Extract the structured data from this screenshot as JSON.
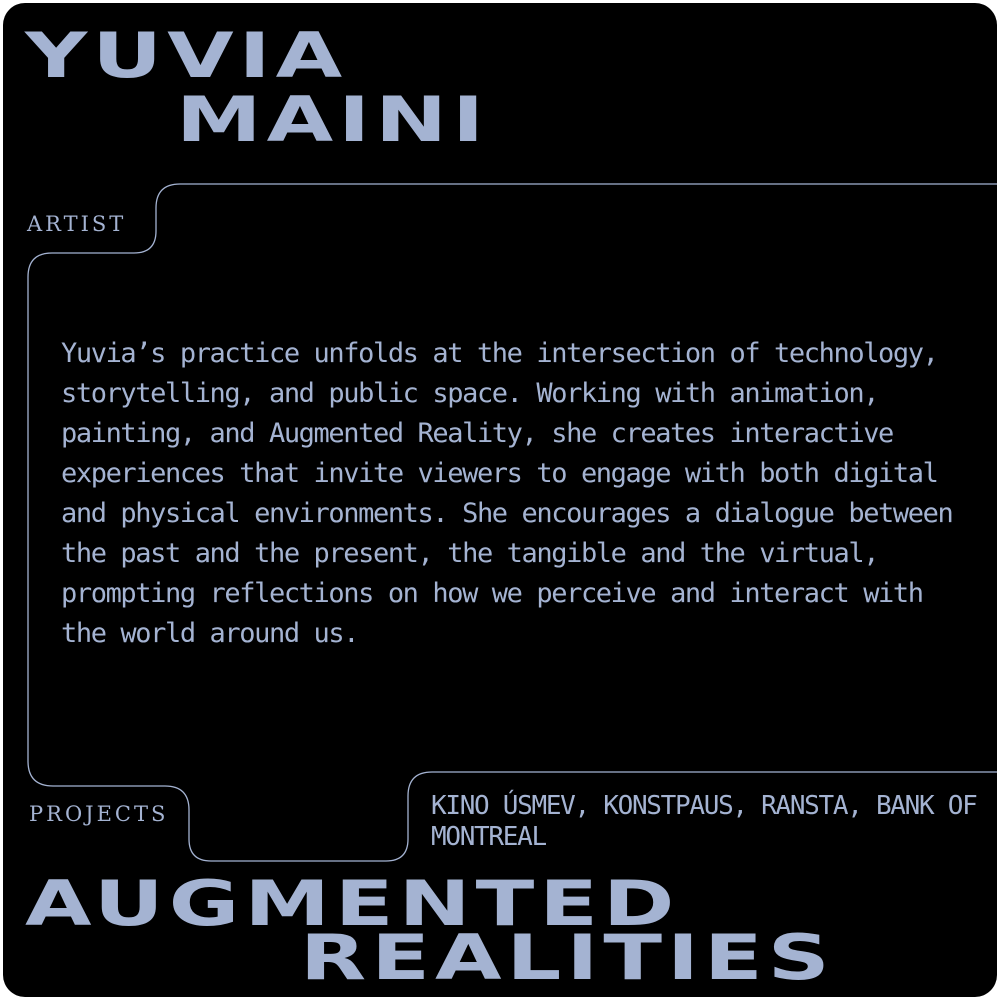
{
  "header": {
    "title_line_1": "YUVIA",
    "title_line_2": "MAINI"
  },
  "artist": {
    "label": "ARTIST",
    "bio": "Yuvia’s practice unfolds at the intersection of technology, storytelling, and public space. Working with animation, painting, and Augmented Reality, she creates interactive experiences that invite viewers to engage with both digital and physical environments. She encourages a dialogue between the past and the present, the tangible and the virtual, prompting reflections on how we perceive and interact with the world around us."
  },
  "projects": {
    "label": "PROJECTS",
    "list": "KINO ÚSMEV, KONSTPAUS, RANSTA, BANK OF MONTREAL"
  },
  "footer": {
    "line_1": "AUGMENTED",
    "line_2": "REALITIES"
  },
  "colors": {
    "background": "#000000",
    "accent": "#a4b3d2"
  }
}
